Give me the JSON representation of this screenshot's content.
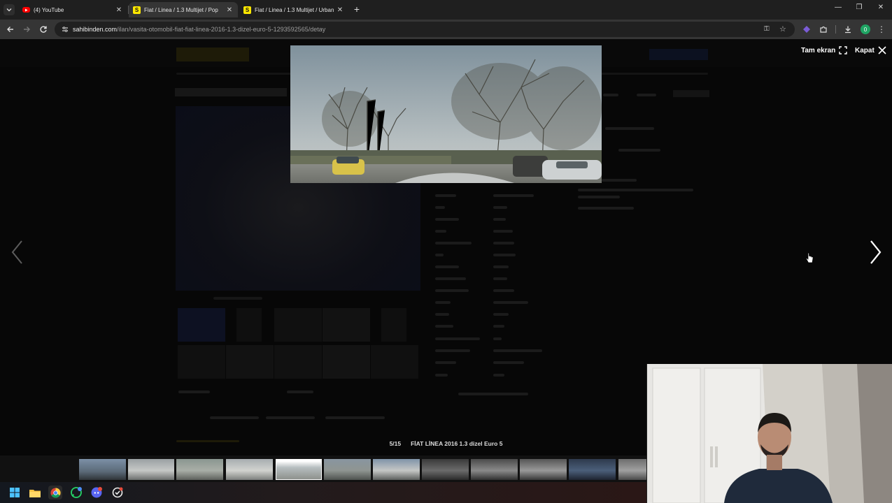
{
  "browser": {
    "tabs": [
      {
        "title": "(4) YouTube",
        "favicon": "youtube-icon",
        "active": false
      },
      {
        "title": "Fiat / Linea / 1.3 Multijet / Pop",
        "favicon": "sahibinden-icon",
        "active": true
      },
      {
        "title": "Fiat / Linea / 1.3 Multijet / Urban",
        "favicon": "sahibinden-icon",
        "active": false
      }
    ],
    "url_host": "sahibinden.com",
    "url_path": "/ilan/vasita-otomobil-fiat-fiat-linea-2016-1.3-dizel-euro-5-1293592565/detay",
    "profile_initial": "0"
  },
  "viewer": {
    "fullscreen_label": "Tam ekran",
    "close_label": "Kapat",
    "counter": "5/15",
    "caption": "FİAT LİNEA 2016 1.3 dizel Euro 5",
    "current_index": 5,
    "total": 15
  },
  "colors": {
    "accent_yellow": "#ffe800",
    "youtube_red": "#ff0000",
    "profile_green": "#1fa463"
  }
}
